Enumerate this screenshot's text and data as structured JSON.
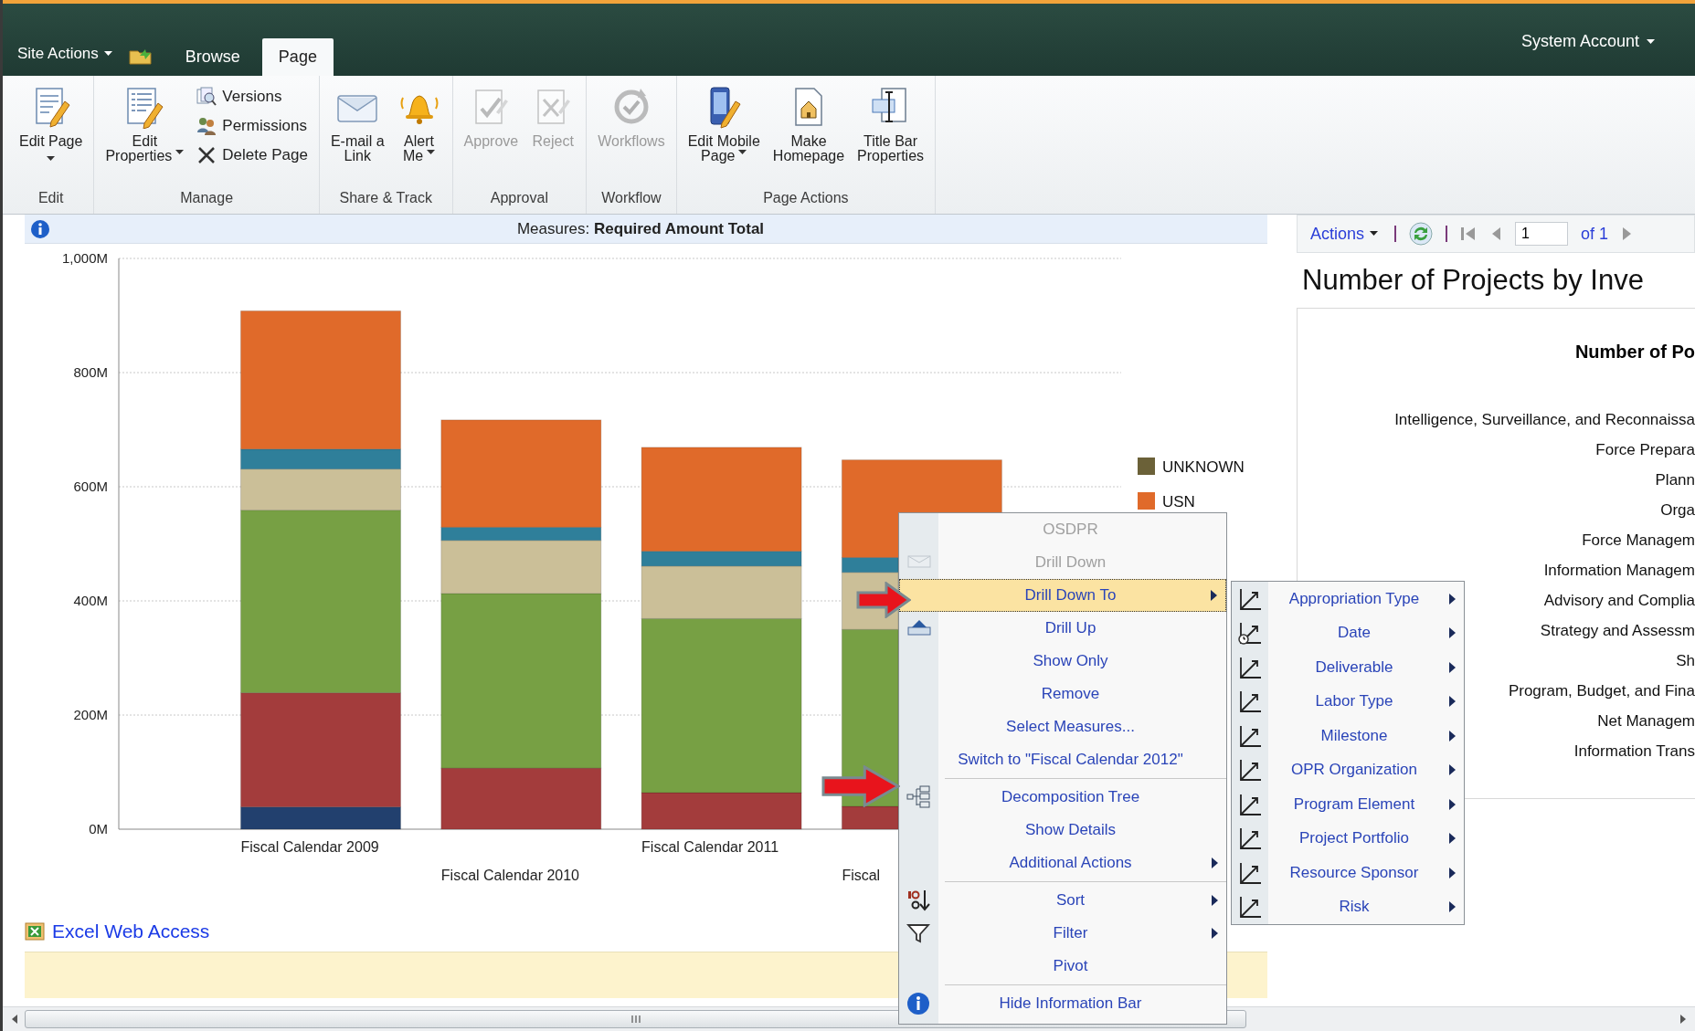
{
  "top_bar": {
    "site_actions": "Site Actions",
    "tabs": [
      {
        "label": "Browse",
        "selected": false
      },
      {
        "label": "Page",
        "selected": true
      }
    ],
    "user": "System Account"
  },
  "ribbon": {
    "groups": [
      {
        "label": "Edit",
        "buttons": [
          {
            "kind": "large",
            "lines": [
              "Edit Page"
            ],
            "dropdown": true,
            "disabled": false
          }
        ]
      },
      {
        "label": "Manage",
        "buttons": [
          {
            "kind": "large",
            "lines": [
              "Edit",
              "Properties"
            ],
            "dropdown": true,
            "disabled": false
          },
          {
            "kind": "small",
            "lines": [
              "Versions"
            ],
            "dropdown": false,
            "disabled": false
          },
          {
            "kind": "small",
            "lines": [
              "Permissions"
            ],
            "dropdown": false,
            "disabled": false
          },
          {
            "kind": "small",
            "lines": [
              "Delete Page"
            ],
            "dropdown": false,
            "disabled": false
          }
        ]
      },
      {
        "label": "Share & Track",
        "buttons": [
          {
            "kind": "large",
            "lines": [
              "E-mail a",
              "Link"
            ],
            "dropdown": false,
            "disabled": false
          },
          {
            "kind": "large",
            "lines": [
              "Alert",
              "Me"
            ],
            "dropdown": true,
            "disabled": false
          }
        ]
      },
      {
        "label": "Approval",
        "buttons": [
          {
            "kind": "large",
            "lines": [
              "Approve"
            ],
            "dropdown": false,
            "disabled": true
          },
          {
            "kind": "large",
            "lines": [
              "Reject"
            ],
            "dropdown": false,
            "disabled": true
          }
        ]
      },
      {
        "label": "Workflow",
        "buttons": [
          {
            "kind": "large",
            "lines": [
              "Workflows"
            ],
            "dropdown": false,
            "disabled": true
          }
        ]
      },
      {
        "label": "Page Actions",
        "buttons": [
          {
            "kind": "large",
            "lines": [
              "Edit Mobile",
              "Page"
            ],
            "dropdown": true,
            "disabled": false
          },
          {
            "kind": "large",
            "lines": [
              "Make",
              "Homepage"
            ],
            "dropdown": false,
            "disabled": false
          },
          {
            "kind": "large",
            "lines": [
              "Title Bar",
              "Properties"
            ],
            "dropdown": false,
            "disabled": false
          }
        ]
      }
    ]
  },
  "info_bar": {
    "text": "Measures: **Required Amount Total**"
  },
  "chart_data": {
    "type": "bar",
    "stacked": true,
    "grid": true,
    "categories": [
      "Fiscal Calendar 2009",
      "Fiscal Calendar 2010",
      "Fiscal Calendar 2011",
      "Fiscal"
    ],
    "ylim": [
      0,
      1000
    ],
    "yticks": [
      {
        "value": 0,
        "label": "0M"
      },
      {
        "value": 200,
        "label": "200M"
      },
      {
        "value": 400,
        "label": "400M"
      },
      {
        "value": 600,
        "label": "600M"
      },
      {
        "value": 800,
        "label": "800M"
      },
      {
        "value": 1000,
        "label": "1,000M"
      }
    ],
    "series": [
      {
        "color": "#22406e",
        "values": [
          39,
          0,
          0,
          0
        ]
      },
      {
        "color": "#a33c3c",
        "values": [
          200,
          107,
          64,
          40
        ]
      },
      {
        "color": "#77a044",
        "values": [
          320,
          306,
          305,
          310
        ]
      },
      {
        "color": "#cbbf98",
        "values": [
          72,
          93,
          92,
          100
        ]
      },
      {
        "color": "#2f7f9a",
        "values": [
          35,
          23,
          26,
          26
        ]
      },
      {
        "name": "USN",
        "color": "#e06a2a",
        "values": [
          242,
          188,
          182,
          171
        ]
      },
      {
        "name": "UNKNOWN",
        "color": "#6b6138",
        "values": [
          0,
          0,
          0,
          0
        ]
      }
    ]
  },
  "excel_web_access": {
    "title": "Excel Web Access"
  },
  "right_panel": {
    "toolbar": {
      "actions": "Actions",
      "page": "1",
      "of": "of 1"
    },
    "title": "Number of Projects by Inve",
    "chart_title": "Number of Po",
    "labels": [
      "Intelligence, Surveillance, and Reconnaissa",
      "Force Prepara",
      "Plann",
      "Orga",
      "Force Managem",
      "Information Managem",
      "Advisory and Complia",
      "Strategy and Assessm",
      "Sh",
      "Program, Budget, and Fina",
      "Net Managem",
      "Information Trans"
    ]
  },
  "context_menu": {
    "items": [
      {
        "label": "OSDPR",
        "disabled": true,
        "selected": false,
        "submenu": false,
        "separator_before": false
      },
      {
        "label": "Drill Down",
        "disabled": true,
        "selected": false,
        "submenu": false,
        "separator_before": false
      },
      {
        "label": "Drill Down To",
        "disabled": false,
        "selected": true,
        "submenu": true,
        "separator_before": false
      },
      {
        "label": "Drill Up",
        "disabled": false,
        "selected": false,
        "submenu": false,
        "separator_before": false
      },
      {
        "label": "Show Only",
        "disabled": false,
        "selected": false,
        "submenu": false,
        "separator_before": false
      },
      {
        "label": "Remove",
        "disabled": false,
        "selected": false,
        "submenu": false,
        "separator_before": false
      },
      {
        "label": "Select Measures...",
        "disabled": false,
        "selected": false,
        "submenu": false,
        "separator_before": false
      },
      {
        "label": "Switch to \"Fiscal Calendar 2012\"",
        "disabled": false,
        "selected": false,
        "submenu": false,
        "separator_before": false
      },
      {
        "label": "Decomposition Tree",
        "disabled": false,
        "selected": false,
        "submenu": false,
        "separator_before": true
      },
      {
        "label": "Show Details",
        "disabled": false,
        "selected": false,
        "submenu": false,
        "separator_before": false
      },
      {
        "label": "Additional Actions",
        "disabled": false,
        "selected": false,
        "submenu": true,
        "separator_before": false
      },
      {
        "label": "Sort",
        "disabled": false,
        "selected": false,
        "submenu": true,
        "separator_before": true
      },
      {
        "label": "Filter",
        "disabled": false,
        "selected": false,
        "submenu": true,
        "separator_before": false
      },
      {
        "label": "Pivot",
        "disabled": false,
        "selected": false,
        "submenu": false,
        "separator_before": false
      },
      {
        "label": "Hide Information Bar",
        "disabled": false,
        "selected": false,
        "submenu": false,
        "separator_before": true
      }
    ]
  },
  "submenu": {
    "items": [
      {
        "label": "Appropriation Type",
        "submenu": true
      },
      {
        "label": "Date",
        "submenu": true
      },
      {
        "label": "Deliverable",
        "submenu": true
      },
      {
        "label": "Labor Type",
        "submenu": true
      },
      {
        "label": "Milestone",
        "submenu": true
      },
      {
        "label": "OPR Organization",
        "submenu": true
      },
      {
        "label": "Program Element",
        "submenu": true
      },
      {
        "label": "Project Portfolio",
        "submenu": true
      },
      {
        "label": "Resource Sponsor",
        "submenu": true
      },
      {
        "label": "Risk",
        "submenu": true
      }
    ]
  }
}
